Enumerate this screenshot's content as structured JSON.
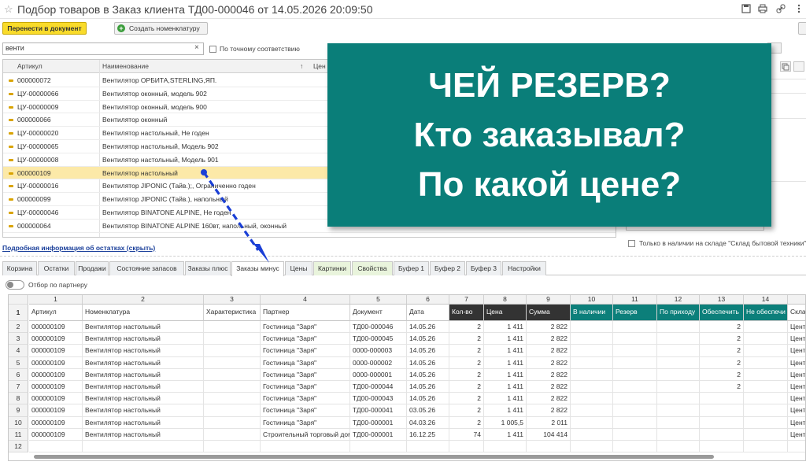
{
  "window": {
    "title": "Подбор товаров в Заказ клиента ТД00-000046 от 14.05.2026 20:09:50",
    "icons": [
      "star-icon",
      "save-icon",
      "print-icon",
      "link-icon",
      "more-icon",
      "restore-icon",
      "close-icon"
    ]
  },
  "toolbar": {
    "transfer_label": "Перенести в документ",
    "create_label": "Создать номенклатуру"
  },
  "search": {
    "value": "венти",
    "exact_label": "По точному соответствию"
  },
  "items_table": {
    "columns": [
      "Артикул",
      "Наименование",
      "Цен"
    ],
    "sort_indicator": "↑",
    "rows": [
      {
        "art": "000000072",
        "name": "Вентилятор ОРБИТА,STERLING,ЯП."
      },
      {
        "art": "ЦУ-00000066",
        "name": "Вентилятор оконный, модель 902"
      },
      {
        "art": "ЦУ-00000009",
        "name": "Вентилятор оконный, модель 900"
      },
      {
        "art": "000000066",
        "name": "Вентилятор оконный"
      },
      {
        "art": "ЦУ-00000020",
        "name": "Вентилятор настольный, Не годен"
      },
      {
        "art": "ЦУ-00000065",
        "name": "Вентилятор настольный, Модель 902"
      },
      {
        "art": "ЦУ-00000008",
        "name": "Вентилятор настольный, Модель 901"
      },
      {
        "art": "000000109",
        "name": "Вентилятор настольный"
      },
      {
        "art": "ЦУ-00000016",
        "name": "Вентилятор JIPONIC (Тайв.);, Ограниченно годен"
      },
      {
        "art": "000000099",
        "name": "Вентилятор JIPONIC (Тайв.), напольный"
      },
      {
        "art": "ЦУ-00000046",
        "name": "Вентилятор BINATONE ALPINE, Не годен"
      },
      {
        "art": "000000064",
        "name": "Вентилятор BINATONE ALPINE 160вт, напольный, оконный"
      }
    ]
  },
  "info_link": "Подробная информация об остатках (скрыть)",
  "right_panel": {
    "only_in_stock_label": "Только в наличии на складе \"Склад бытовой техники\""
  },
  "tabs": [
    {
      "label": "Корзина",
      "active": false,
      "green": false
    },
    {
      "label": "Остатки",
      "active": false,
      "green": false
    },
    {
      "label": "Продажи",
      "active": false,
      "green": false
    },
    {
      "label": "Состояние запасов",
      "active": false,
      "green": false
    },
    {
      "label": "Заказы плюс",
      "active": false,
      "green": false
    },
    {
      "label": "Заказы минус",
      "active": true,
      "green": false
    },
    {
      "label": "Цены",
      "active": false,
      "green": false
    },
    {
      "label": "Картинки",
      "active": false,
      "green": true
    },
    {
      "label": "Свойства",
      "active": false,
      "green": true
    },
    {
      "label": "Буфер 1",
      "active": false,
      "green": false
    },
    {
      "label": "Буфер 2",
      "active": false,
      "green": false
    },
    {
      "label": "Буфер 3",
      "active": false,
      "green": false
    },
    {
      "label": "Настройки",
      "active": false,
      "green": false
    }
  ],
  "partner_filter_label": "Отбор по партнеру",
  "sheet": {
    "col_numbers": [
      "1",
      "2",
      "3",
      "4",
      "5",
      "6",
      "7",
      "8",
      "9",
      "10",
      "11",
      "12",
      "13",
      "14",
      ""
    ],
    "headers": [
      "Артикул",
      "Номенклатура",
      "Характеристика",
      "Партнер",
      "Документ",
      "Дата",
      "Кол-во",
      "Цена",
      "Сумма",
      "В наличии",
      "Резерв",
      "По приходу",
      "Обеспечить",
      "Не обеспечи",
      "Склад"
    ],
    "header_styles": [
      "",
      "",
      "",
      "",
      "",
      "",
      "dark",
      "dark",
      "dark",
      "teal",
      "teal",
      "teal",
      "teal",
      "teal",
      ""
    ],
    "row_numbers": [
      "1",
      "2",
      "3",
      "4",
      "5",
      "6",
      "7",
      "8",
      "9",
      "10",
      "11",
      "12"
    ],
    "rows": [
      [
        "000000109",
        "Вентилятор настольный",
        "",
        "Гостиница \"Заря\"",
        "ТД00-000046",
        "14.05.26",
        "2",
        "1 411",
        "2 822",
        "",
        "",
        "",
        "2",
        "",
        "Центр"
      ],
      [
        "000000109",
        "Вентилятор настольный",
        "",
        "Гостиница \"Заря\"",
        "ТД00-000045",
        "14.05.26",
        "2",
        "1 411",
        "2 822",
        "",
        "",
        "",
        "2",
        "",
        "Центр"
      ],
      [
        "000000109",
        "Вентилятор настольный",
        "",
        "Гостиница \"Заря\"",
        "0000-000003",
        "14.05.26",
        "2",
        "1 411",
        "2 822",
        "",
        "",
        "",
        "2",
        "",
        "Центр"
      ],
      [
        "000000109",
        "Вентилятор настольный",
        "",
        "Гостиница \"Заря\"",
        "0000-000002",
        "14.05.26",
        "2",
        "1 411",
        "2 822",
        "",
        "",
        "",
        "2",
        "",
        "Центр"
      ],
      [
        "000000109",
        "Вентилятор настольный",
        "",
        "Гостиница \"Заря\"",
        "0000-000001",
        "14.05.26",
        "2",
        "1 411",
        "2 822",
        "",
        "",
        "",
        "2",
        "",
        "Центр"
      ],
      [
        "000000109",
        "Вентилятор настольный",
        "",
        "Гостиница \"Заря\"",
        "ТД00-000044",
        "14.05.26",
        "2",
        "1 411",
        "2 822",
        "",
        "",
        "",
        "2",
        "",
        "Центр"
      ],
      [
        "000000109",
        "Вентилятор настольный",
        "",
        "Гостиница \"Заря\"",
        "ТД00-000043",
        "14.05.26",
        "2",
        "1 411",
        "2 822",
        "",
        "",
        "",
        "",
        "",
        "Центр"
      ],
      [
        "000000109",
        "Вентилятор настольный",
        "",
        "Гостиница \"Заря\"",
        "ТД00-000041",
        "03.05.26",
        "2",
        "1 411",
        "2 822",
        "",
        "",
        "",
        "",
        "",
        "Центр"
      ],
      [
        "000000109",
        "Вентилятор настольный",
        "",
        "Гостиница \"Заря\"",
        "ТД00-000001",
        "04.03.26",
        "2",
        "1 005,5",
        "2 011",
        "",
        "",
        "",
        "",
        "",
        "Центр"
      ],
      [
        "000000109",
        "Вентилятор настольный",
        "",
        "Строительный торговый дом",
        "ТД00-000001",
        "16.12.25",
        "74",
        "1 411",
        "104 414",
        "",
        "",
        "",
        "",
        "",
        "Центр"
      ]
    ]
  },
  "overlay": {
    "lines": [
      "ЧЕЙ РЕЗЕРВ?",
      "Кто заказывал?",
      "По какой цене?"
    ],
    "bg_color": "#0a7e79"
  },
  "colors": {
    "accent_yellow": "#f9db2a",
    "selected_row": "#fce9a8",
    "teal_header": "#0c7f7a",
    "dark_header": "#333333",
    "arrow": "#1a3fd6"
  }
}
